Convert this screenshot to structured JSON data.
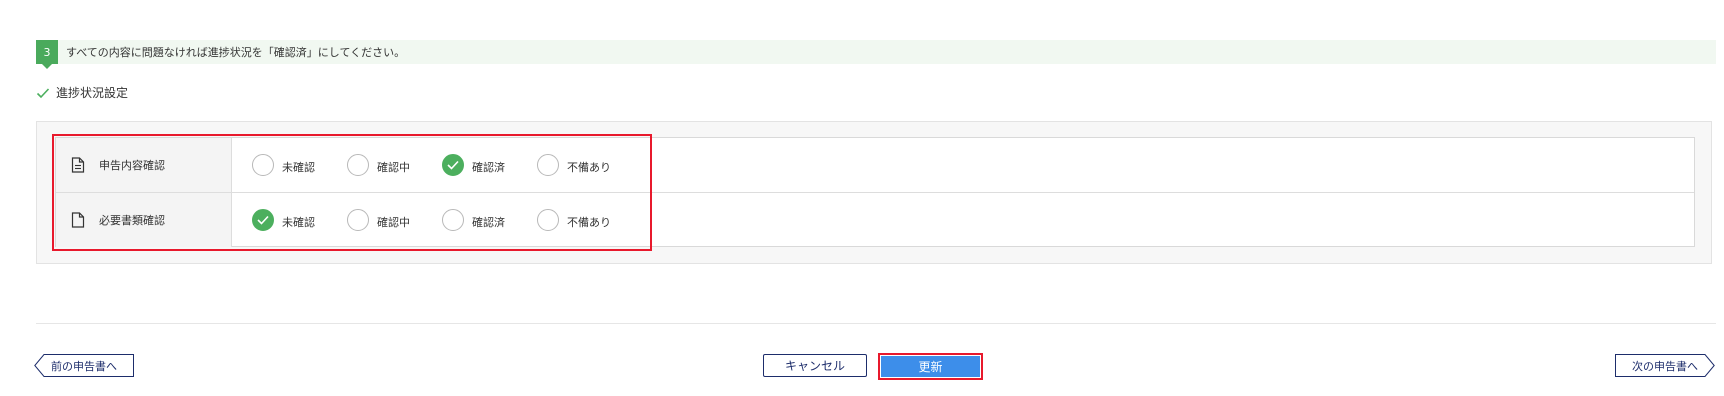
{
  "step": {
    "number": "3",
    "text": "すべての内容に問題なければ進捗状況を「確認済」にしてください。"
  },
  "section": {
    "title": "進捗状況設定"
  },
  "status_rows": [
    {
      "label": "申告内容確認",
      "icon": "document-lines-icon",
      "options": [
        "未確認",
        "確認中",
        "確認済",
        "不備あり"
      ],
      "selected": "確認済"
    },
    {
      "label": "必要書類確認",
      "icon": "document-icon",
      "options": [
        "未確認",
        "確認中",
        "確認済",
        "不備あり"
      ],
      "selected": "未確認"
    }
  ],
  "footer": {
    "prev_label": "前の申告書へ",
    "cancel_label": "キャンセル",
    "update_label": "更新",
    "next_label": "次の申告書へ"
  },
  "colors": {
    "accent_green": "#4caf5e",
    "primary_blue": "#3d8eea",
    "navy": "#1d2d6b",
    "highlight_red": "#e8192c"
  }
}
